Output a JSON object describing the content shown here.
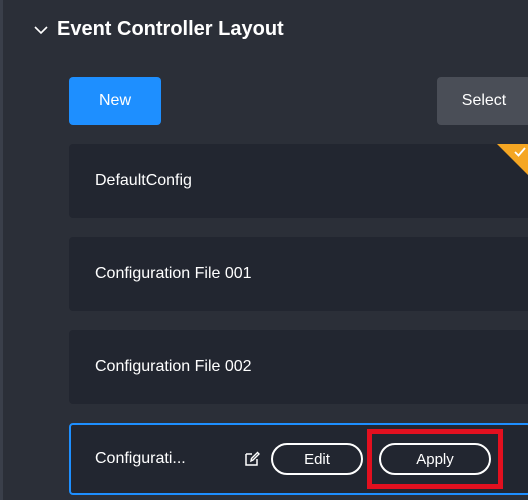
{
  "section": {
    "title": "Event Controller Layout"
  },
  "toolbar": {
    "new_label": "New",
    "select_label": "Select"
  },
  "configs": [
    {
      "name": "DefaultConfig",
      "active": true
    },
    {
      "name": "Configuration File 001"
    },
    {
      "name": "Configuration File 002"
    },
    {
      "name": "Configurati...",
      "edit_label": "Edit",
      "apply_label": "Apply"
    }
  ],
  "colors": {
    "accent": "#1e8fff",
    "active_badge": "#f5a623",
    "highlight": "#e3101f"
  },
  "icons": {
    "collapse": "chevron-down-icon",
    "active": "checkmark-icon",
    "rename": "edit-icon"
  }
}
